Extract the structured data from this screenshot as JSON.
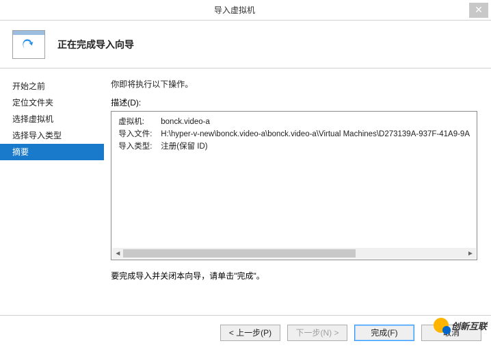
{
  "window": {
    "title": "导入虚拟机"
  },
  "header": {
    "title": "正在完成导入向导"
  },
  "sidebar": {
    "items": [
      {
        "label": "开始之前"
      },
      {
        "label": "定位文件夹"
      },
      {
        "label": "选择虚拟机"
      },
      {
        "label": "选择导入类型"
      },
      {
        "label": "摘要"
      }
    ],
    "selected_index": 4
  },
  "main": {
    "intro": "你即将执行以下操作。",
    "desc_label": "描述(D):",
    "rows": [
      {
        "key": "虚拟机:",
        "val": "bonck.video-a"
      },
      {
        "key": "导入文件:",
        "val": "H:\\hyper-v-new\\bonck.video-a\\bonck.video-a\\Virtual Machines\\D273139A-937F-41A9-9A"
      },
      {
        "key": "导入类型:",
        "val": "注册(保留 ID)"
      }
    ],
    "finish_text": "要完成导入并关闭本向导，请单击\"完成\"。"
  },
  "footer": {
    "prev": "< 上一步(P)",
    "next": "下一步(N) >",
    "finish": "完成(F)",
    "cancel": "取消"
  },
  "watermark": "创新互联"
}
